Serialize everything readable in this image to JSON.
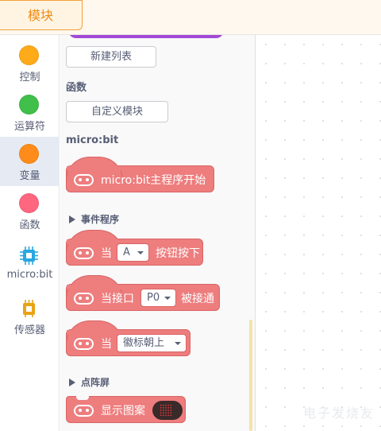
{
  "topbar": {
    "tab_label": "模块"
  },
  "categories": [
    {
      "label": "控制",
      "color": "#FFAB19"
    },
    {
      "label": "运算符",
      "color": "#40BF4A"
    },
    {
      "label": "变量",
      "color": "#FF8C1A"
    },
    {
      "label": "函数",
      "color": "#FF6680"
    },
    {
      "label": "micro:bit",
      "color": "#29A7E1"
    },
    {
      "label": "传感器",
      "color": "#E8A317"
    }
  ],
  "flyout": {
    "new_list_button": "新建列表",
    "functions_heading": "函数",
    "define_block_button": "自定义模块",
    "microbit_heading": "micro:bit",
    "main_program_block": "micro:bit主程序开始",
    "events_subheading": "事件程序",
    "button_pressed": {
      "prefix": "当",
      "dropdown": "A",
      "suffix": "按钮按下"
    },
    "pin_connected": {
      "prefix": "当接口",
      "dropdown": "P0",
      "suffix": "被接通"
    },
    "logo_up": {
      "prefix": "当",
      "dropdown": "徽标朝上"
    },
    "matrix_subheading": "点阵屏",
    "show_image_block": "显示图案"
  },
  "colors": {
    "block": "#EE7D7E",
    "accent": "#F08A14"
  },
  "watermark": "电子发烧友"
}
